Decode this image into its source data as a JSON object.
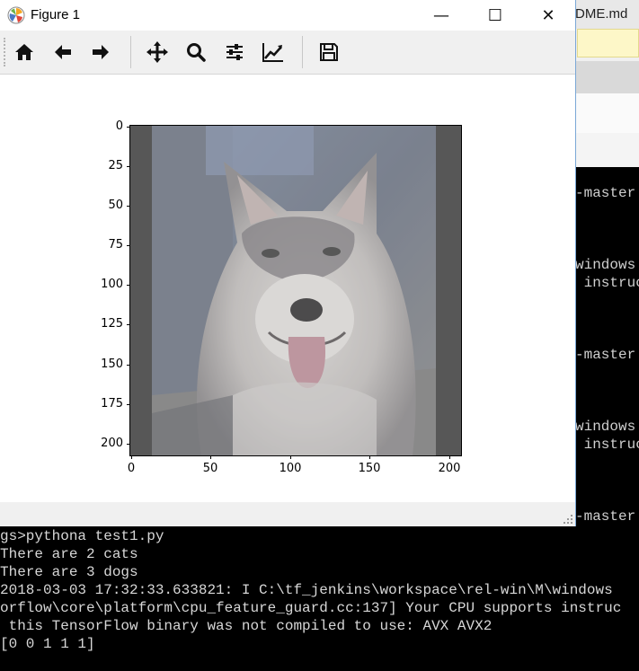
{
  "window": {
    "title": "Figure 1",
    "minimize": "—",
    "maximize": "☐",
    "close": "✕"
  },
  "toolbar": {
    "buttons": [
      {
        "name": "home-icon"
      },
      {
        "name": "back-arrow-icon"
      },
      {
        "name": "forward-arrow-icon"
      },
      {
        "name": "pan-icon"
      },
      {
        "name": "zoom-icon"
      },
      {
        "name": "configure-subplots-icon"
      },
      {
        "name": "edit-axis-icon"
      },
      {
        "name": "save-icon"
      }
    ]
  },
  "plot": {
    "y_ticks": [
      "0",
      "25",
      "50",
      "75",
      "100",
      "125",
      "150",
      "175",
      "200"
    ],
    "x_ticks": [
      "0",
      "50",
      "100",
      "150",
      "200"
    ],
    "image": "husky-dog-photo"
  },
  "chart_data": {
    "type": "image",
    "xlim": [
      0,
      208
    ],
    "ylim": [
      208,
      0
    ],
    "xticks": [
      0,
      50,
      100,
      150,
      200
    ],
    "yticks": [
      0,
      25,
      50,
      75,
      100,
      125,
      150,
      175,
      200
    ],
    "title": "",
    "xlabel": "",
    "ylabel": ""
  },
  "background_editor": {
    "tab_label": "DME.md"
  },
  "background_console": {
    "lines": [
      "-master",
      "windows",
      " instruc",
      "-master",
      "windows",
      " instruc",
      "-master"
    ]
  },
  "console": {
    "lines": [
      "gs>pythona test1.py",
      "There are 2 cats",
      "There are 3 dogs",
      "2018-03-03 17:32:33.633821: I C:\\tf_jenkins\\workspace\\rel-win\\M\\windows",
      "orflow\\core\\platform\\cpu_feature_guard.cc:137] Your CPU supports instruc",
      " this TensorFlow binary was not compiled to use: AVX AVX2",
      "[0 0 1 1 1]"
    ]
  }
}
